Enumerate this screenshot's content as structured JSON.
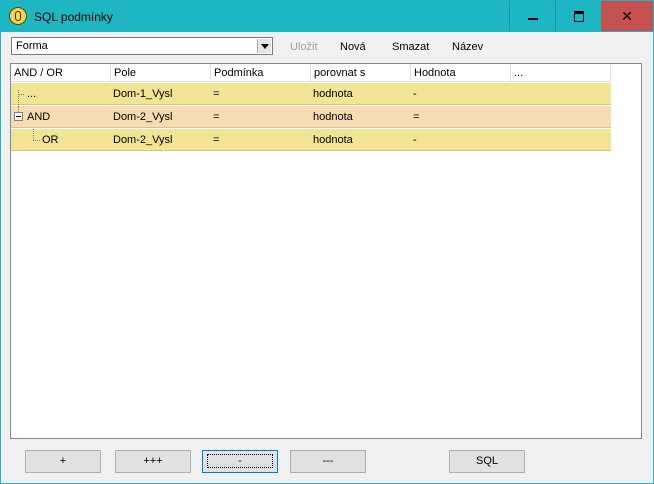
{
  "window": {
    "title": "SQL podmínky"
  },
  "toolbar": {
    "combo_value": "Forma",
    "save_label": "Uložit",
    "new_label": "Nová",
    "delete_label": "Smazat",
    "name_label": "Název"
  },
  "grid": {
    "columns": [
      "AND / OR",
      "Pole",
      "Podmínka",
      "porovnat s",
      "Hodnota",
      "..."
    ],
    "rows": [
      {
        "op": "...",
        "field": "Dom-1_Vysl",
        "cond": "=",
        "compare": "hodnota",
        "value": "-"
      },
      {
        "op": "AND",
        "field": "Dom-2_Vysl",
        "cond": "=",
        "compare": "hodnota",
        "value": "="
      },
      {
        "op": "OR",
        "field": "Dom-2_Vysl",
        "cond": "=",
        "compare": "hodnota",
        "value": "-"
      }
    ]
  },
  "buttons": {
    "add": "+",
    "add_multi": "+++",
    "remove": "-",
    "remove_multi": "---",
    "sql": "SQL"
  },
  "colors": {
    "titlebar": "#1fb6c4",
    "close": "#c75050",
    "row_yellow": "#f1e595",
    "row_peach": "#f6dcb3"
  }
}
